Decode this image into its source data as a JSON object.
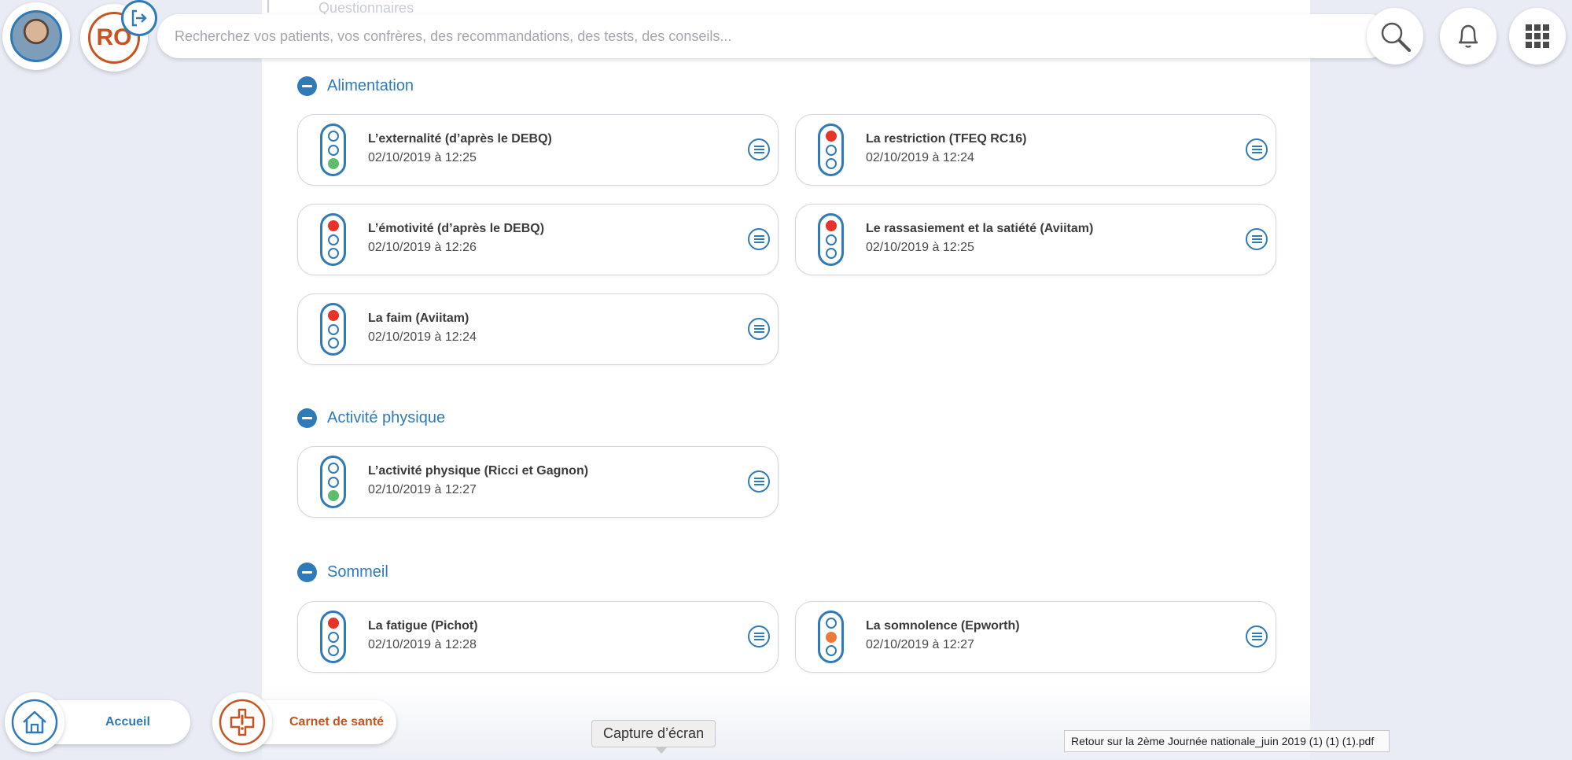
{
  "header": {
    "avatar_alt": "profile photo",
    "ro_initials": "RO",
    "search_placeholder": "Recherchez vos patients, vos confrères, des recommandations, des tests, des conseils...",
    "ghost_title": "Questionnaires"
  },
  "sections": [
    {
      "title": "Alimentation",
      "cards": [
        {
          "title": "L’externalité (d’après le DEBQ)",
          "date": "02/10/2019 à 12:25",
          "light": "green"
        },
        {
          "title": "La restriction (TFEQ RC16)",
          "date": "02/10/2019 à 12:24",
          "light": "red"
        },
        {
          "title": "L’émotivité (d’après le DEBQ)",
          "date": "02/10/2019 à 12:26",
          "light": "red"
        },
        {
          "title": "Le rassasiement et la satiété (Aviitam)",
          "date": "02/10/2019 à 12:25",
          "light": "red"
        },
        {
          "title": "La faim (Aviitam)",
          "date": "02/10/2019 à 12:24",
          "light": "red"
        }
      ]
    },
    {
      "title": "Activité physique",
      "cards": [
        {
          "title": "L’activité physique (Ricci et Gagnon)",
          "date": "02/10/2019 à 12:27",
          "light": "green"
        }
      ]
    },
    {
      "title": "Sommeil",
      "cards": [
        {
          "title": "La fatigue (Pichot)",
          "date": "02/10/2019 à 12:28",
          "light": "red"
        },
        {
          "title": "La somnolence (Epworth)",
          "date": "02/10/2019 à 12:27",
          "light": "orange"
        }
      ]
    }
  ],
  "bottom": {
    "home_label": "Accueil",
    "health_label": "Carnet de santé",
    "tooltip": "Capture d’écran",
    "file_tooltip": "Retour sur la 2ème Journée nationale_juin 2019 (1) (1) (1).pdf"
  },
  "colors": {
    "accent_blue": "#2f7ab9",
    "accent_orange": "#c8531f",
    "light_red": "#e8332b",
    "light_green": "#5dbd6a",
    "light_orange": "#ee7a3a"
  }
}
